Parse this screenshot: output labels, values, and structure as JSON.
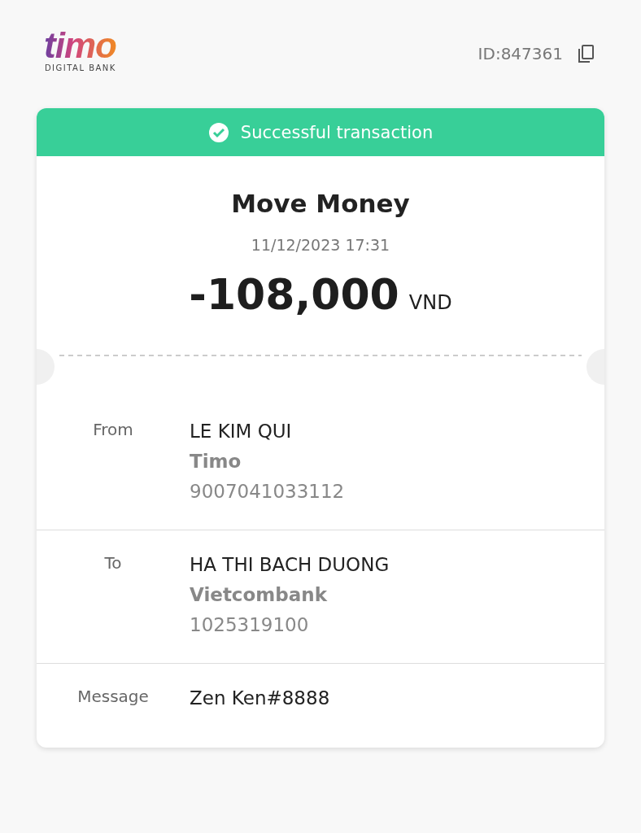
{
  "brand": {
    "name": "timo",
    "tagline": "DIGITAL BANK"
  },
  "transaction_id": "ID:847361",
  "status": {
    "text": "Successful transaction",
    "kind": "success"
  },
  "title": "Move Money",
  "datetime": "11/12/2023 17:31",
  "amount": {
    "value": "-108,000",
    "currency": "VND"
  },
  "details": [
    {
      "label": "From",
      "lines": [
        "LE KIM QUI",
        "Timo",
        "9007041033112"
      ]
    },
    {
      "label": "To",
      "lines": [
        "HA THI BACH DUONG",
        "Vietcombank",
        "1025319100"
      ]
    },
    {
      "label": "Message",
      "lines": [
        "Zen Ken#8888"
      ]
    }
  ]
}
